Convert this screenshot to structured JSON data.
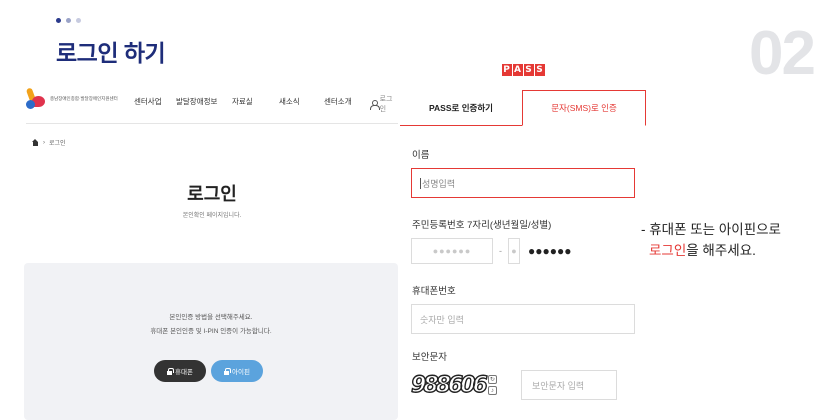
{
  "slide": {
    "heading": "로그인 하기",
    "number": "02"
  },
  "site": {
    "logo_text": "충남장애인종합·발달장애인지원센터",
    "nav": [
      "센터사업",
      "발달장애정보",
      "자료실",
      "새소식",
      "센터소개"
    ],
    "login_link": "로그인",
    "breadcrumb": "로그인",
    "page_title": "로그인",
    "page_subtitle": "본인확인 페이지입니다.",
    "box_line1": "본인인증 방법을 선택해주세요.",
    "box_line2": "휴대폰 본인인증 및 I-PIN 인증이 가능합니다.",
    "phone_button": "휴대폰",
    "ipin_button": "아이핀"
  },
  "pass": {
    "logo_letters": [
      "P",
      "A",
      "S",
      "S"
    ],
    "tab_pass": "PASS로 인증하기",
    "tab_sms": "문자(SMS)로 인증",
    "name_label": "이름",
    "name_placeholder": "성명입력",
    "rrn_label": "주민등록번호 7자리(생년월일/성별)",
    "rrn_front": "●●●●●●",
    "rrn_dash": "-",
    "rrn_back": "●",
    "rrn_mask": "●●●●●●",
    "phone_label": "휴대폰번호",
    "phone_placeholder": "숫자만 입력",
    "captcha_label": "보안문자",
    "captcha_text": "988606",
    "captcha_placeholder": "보안문자 입력"
  },
  "note": {
    "line1": "- 휴대폰 또는 아이핀으로",
    "highlight": "로그인",
    "line2_rest": "을 해주세요."
  },
  "colors": {
    "heading": "#1e2d7a",
    "accent_red": "#e53935",
    "ipin_blue": "#5ba3dd"
  }
}
